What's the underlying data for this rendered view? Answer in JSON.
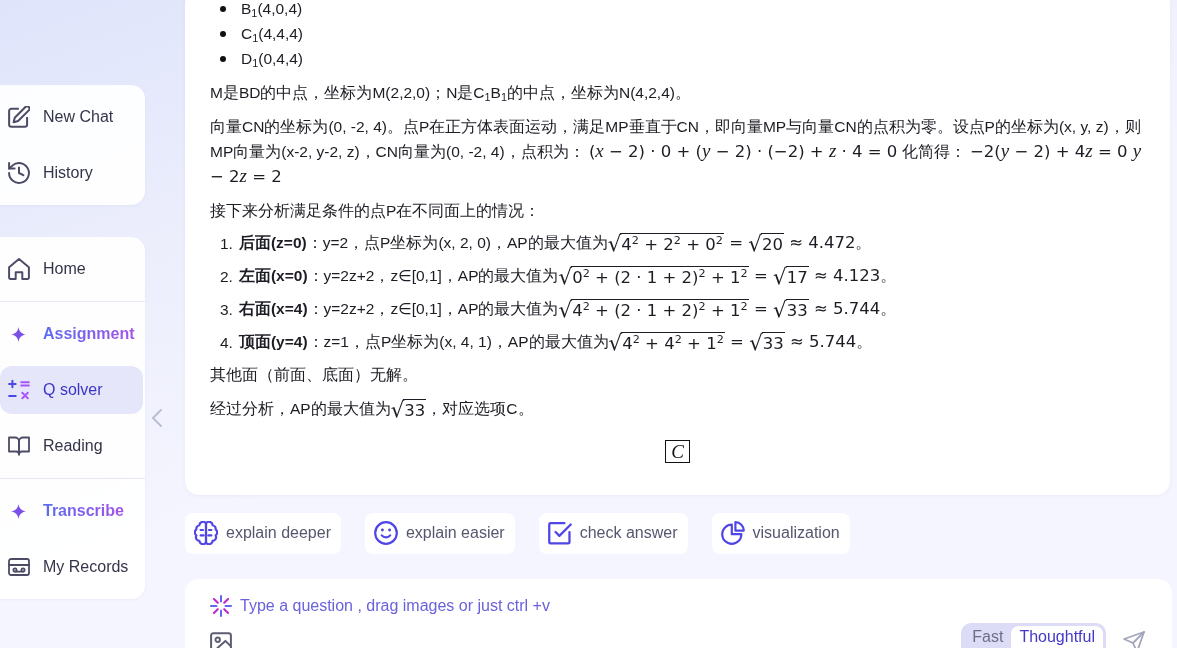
{
  "sidebar": {
    "actions": [
      {
        "label": "New Chat"
      },
      {
        "label": "History"
      }
    ],
    "nav": [
      {
        "label": "Home",
        "kind": "link",
        "selected": false
      },
      {
        "label": "Assignment",
        "kind": "feature",
        "selected": false
      },
      {
        "label": "Q solver",
        "kind": "link",
        "selected": true
      },
      {
        "label": "Reading",
        "kind": "link",
        "selected": false
      },
      {
        "label": "Transcribe",
        "kind": "feature",
        "selected": false
      },
      {
        "label": "My Records",
        "kind": "link",
        "selected": false
      }
    ]
  },
  "answer": {
    "blocks": [
      {
        "kind": "bullets",
        "items": [
          "B$_{1}$(4,0,4)",
          "C$_{1}$(4,4,4)",
          "D$_{1}$(0,4,4)"
        ]
      },
      {
        "kind": "paragraph",
        "parts": [
          {
            "kind": "text",
            "text": "M是BD的中点，坐标为M(2,2,0)；N是C$_{1}$B$_{1}$的中点，坐标为N(4,2,4)。"
          }
        ]
      },
      {
        "kind": "paragraph",
        "parts": [
          {
            "kind": "text",
            "text": "向量CN的坐标为(0, -2, 4)。点P在正方体表面运动，满足MP垂直于CN，即向量MP与向量CN的点积为零。设点P的坐标为(x, y, z)，则MP向量为(x-2, y-2, z)，CN向量为(0, -2, 4)，点积为： "
          },
          {
            "kind": "math",
            "text": "(*x* − 2) · 0 + (*y* − 2) · (−2) + *z* · 4 = 0"
          },
          {
            "kind": "text",
            "text": " 化简得： "
          },
          {
            "kind": "math",
            "text": "−2(*y* − 2) + 4"
          },
          {
            "kind": "math",
            "text": "*z* = 0 *y* − 2"
          },
          {
            "kind": "math",
            "text": "*z* = 2"
          }
        ]
      },
      {
        "kind": "paragraph",
        "parts": [
          {
            "kind": "text",
            "text": "接下来分析满足条件的点P在不同面上的情况："
          }
        ]
      },
      {
        "kind": "numbered",
        "items": [
          {
            "number": "1.",
            "parts": [
              {
                "kind": "text",
                "text": "**后面(z=0)**：y=2，点P坐标为(x, 2, 0)，AP的最大值为"
              },
              {
                "kind": "sqrt",
                "sign": "√",
                "text": "4$^{2}$ + 2$^{2}$ + 0$^{2}$"
              },
              {
                "kind": "math",
                "text": " = "
              },
              {
                "kind": "sqrt",
                "sign": "√",
                "text": "20"
              },
              {
                "kind": "math",
                "text": " ≈ 4.472。"
              }
            ]
          },
          {
            "number": "2.",
            "parts": [
              {
                "kind": "text",
                "text": "**左面(x=0)**：y=2z+2，z∈[0,1]，AP的最大值为"
              },
              {
                "kind": "sqrt",
                "sign": "√",
                "text": "0$^{2}$ + (2 · 1 + 2)$^{2}$ + 1$^{2}$"
              },
              {
                "kind": "math",
                "text": " = "
              },
              {
                "kind": "sqrt",
                "sign": "√",
                "text": "17"
              },
              {
                "kind": "math",
                "text": " ≈ 4.123。"
              }
            ]
          },
          {
            "number": "3.",
            "parts": [
              {
                "kind": "text",
                "text": "**右面(x=4)**：y=2z+2，z∈[0,1]，AP的最大值为"
              },
              {
                "kind": "sqrt",
                "sign": "√",
                "text": "4$^{2}$ + (2 · 1 + 2)$^{2}$ + 1$^{2}$"
              },
              {
                "kind": "math",
                "text": " = "
              },
              {
                "kind": "sqrt",
                "sign": "√",
                "text": "33"
              },
              {
                "kind": "math",
                "text": " ≈ 5.744。"
              }
            ]
          },
          {
            "number": "4.",
            "parts": [
              {
                "kind": "text",
                "text": "**顶面(y=4)**：z=1，点P坐标为(x, 4, 1)，AP的最大值为"
              },
              {
                "kind": "sqrt",
                "sign": "√",
                "text": "4$^{2}$ + 4$^{2}$ + 1$^{2}$"
              },
              {
                "kind": "math",
                "text": " = "
              },
              {
                "kind": "sqrt",
                "sign": "√",
                "text": "33"
              },
              {
                "kind": "math",
                "text": " ≈ 5.744。"
              }
            ]
          }
        ]
      },
      {
        "kind": "paragraph",
        "parts": [
          {
            "kind": "text",
            "text": "其他面（前面、底面）无解。"
          }
        ]
      },
      {
        "kind": "paragraph",
        "parts": [
          {
            "kind": "text",
            "text": "经过分析，AP的最大值为"
          },
          {
            "kind": "sqrt",
            "sign": "√",
            "text": "33"
          },
          {
            "kind": "text",
            "text": "，对应选项C。"
          }
        ]
      },
      {
        "kind": "boxed",
        "text": "C"
      }
    ]
  },
  "suggestions": [
    {
      "label": "explain deeper"
    },
    {
      "label": "explain easier"
    },
    {
      "label": "check answer"
    },
    {
      "label": "visualization"
    }
  ],
  "composer": {
    "placeholder": "Type a question , drag images or just ctrl +v",
    "modes": [
      {
        "label": "Fast",
        "selected": false
      },
      {
        "label": "Thoughtful",
        "selected": true
      }
    ]
  }
}
